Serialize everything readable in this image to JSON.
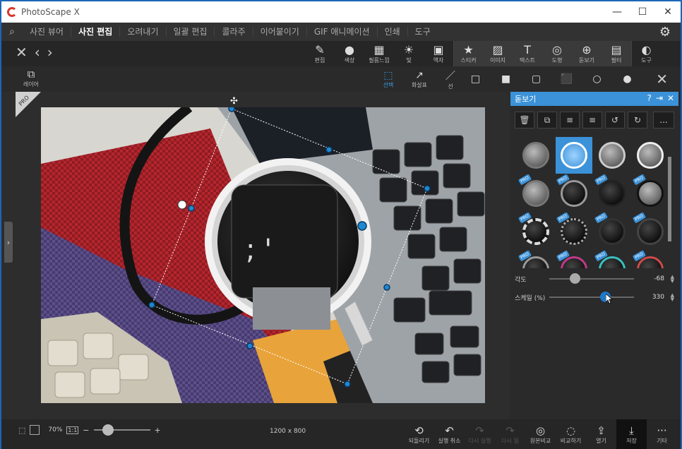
{
  "app": {
    "title": "PhotoScape X"
  },
  "window_controls": {
    "minimize": "—",
    "maximize": "☐",
    "close": "✕"
  },
  "menu": {
    "tabs": [
      {
        "label": "사진 뷰어",
        "active": false
      },
      {
        "label": "사진 편집",
        "active": true
      },
      {
        "label": "오려내기",
        "active": false
      },
      {
        "label": "일괄 편집",
        "active": false
      },
      {
        "label": "콜라주",
        "active": false
      },
      {
        "label": "이어붙이기",
        "active": false
      },
      {
        "label": "GIF 애니메이션",
        "active": false
      },
      {
        "label": "인쇄",
        "active": false
      },
      {
        "label": "도구",
        "active": false
      }
    ]
  },
  "toolbar": {
    "tools": [
      {
        "label": "편집",
        "icon": "✎"
      },
      {
        "label": "색상",
        "icon": "●"
      },
      {
        "label": "필름느낌",
        "icon": "▦"
      },
      {
        "label": "빛",
        "icon": "☀"
      },
      {
        "label": "액자",
        "icon": "▣"
      },
      {
        "label": "스티커",
        "icon": "★"
      },
      {
        "label": "이미지",
        "icon": "▨"
      },
      {
        "label": "텍스트",
        "icon": "T"
      },
      {
        "label": "도형",
        "icon": "◎"
      },
      {
        "label": "돋보기",
        "icon": "⊕"
      },
      {
        "label": "필터",
        "icon": "▤"
      },
      {
        "label": "도구",
        "icon": "◐"
      }
    ]
  },
  "subbar": {
    "layer_label": "레이어",
    "tools": [
      {
        "label": "선택",
        "icon": "⬚"
      },
      {
        "label": "화살표",
        "icon": "↗"
      },
      {
        "label": "선",
        "icon": "／"
      }
    ]
  },
  "panel": {
    "title": "돋보기",
    "help": "?",
    "pin": "⇥",
    "close": "✕",
    "more": "...",
    "pro_label": "PRO",
    "sliders": [
      {
        "label": "각도",
        "value": "-68",
        "fraction": 0.3
      },
      {
        "label": "스케일 (%)",
        "value": "330",
        "fraction": 0.66
      }
    ]
  },
  "canvas": {
    "pro_badge": "PRO"
  },
  "status": {
    "zoom": "70%",
    "one_to_one": "1:1",
    "zoom_fraction": 0.15,
    "dimensions": "1200 x 800"
  },
  "bottom_tools": [
    {
      "label": "되돌리기",
      "icon": "⟲",
      "disabled": false,
      "save": false
    },
    {
      "label": "실행 취소",
      "icon": "↶",
      "disabled": false,
      "save": false
    },
    {
      "label": "다시 실행",
      "icon": "↷",
      "disabled": true,
      "save": false
    },
    {
      "label": "다시 됨",
      "icon": "↷",
      "disabled": true,
      "save": false
    },
    {
      "label": "원본비교",
      "icon": "◎",
      "disabled": false,
      "save": false
    },
    {
      "label": "비교하기",
      "icon": "◌",
      "disabled": false,
      "save": false
    },
    {
      "label": "열기",
      "icon": "⇪",
      "disabled": false,
      "save": false
    },
    {
      "label": "저장",
      "icon": "⤓",
      "disabled": false,
      "save": true
    },
    {
      "label": "기타",
      "icon": "···",
      "disabled": false,
      "save": false
    }
  ]
}
